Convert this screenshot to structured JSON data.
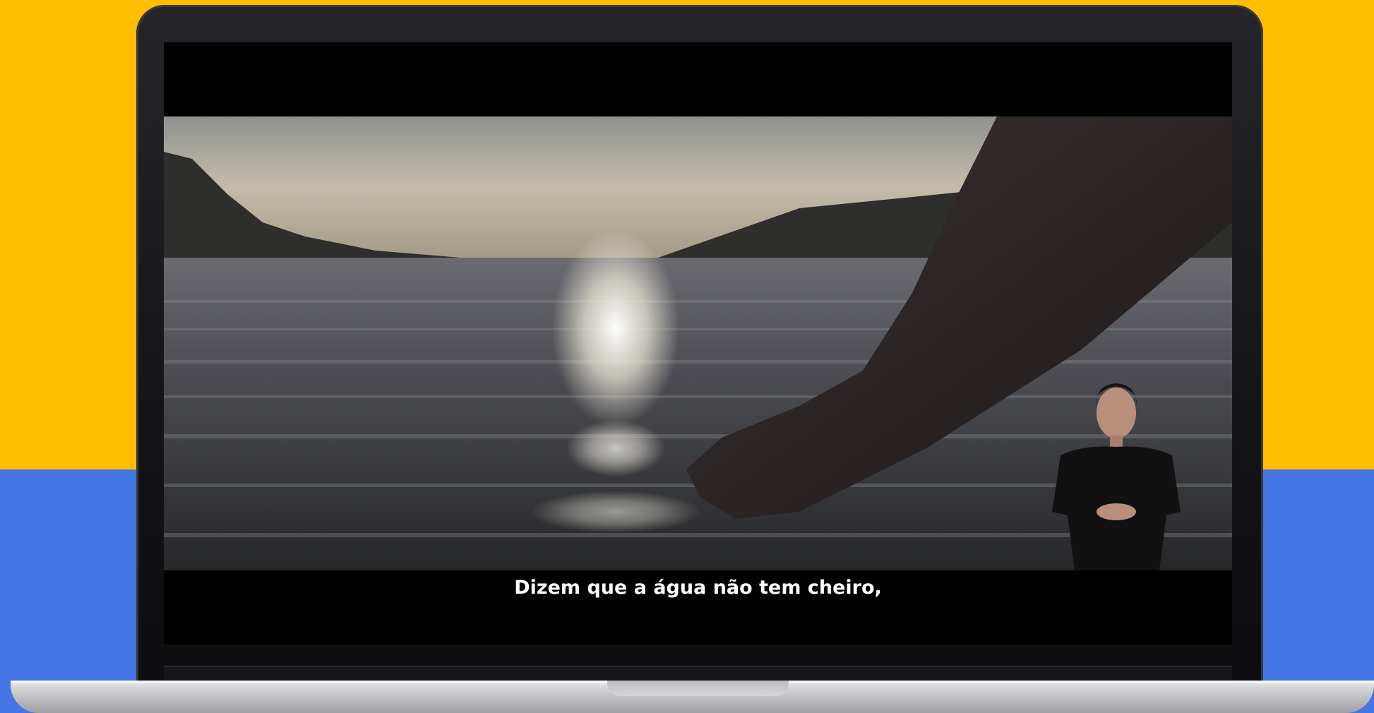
{
  "video": {
    "subtitle": "Dizem que a água não tem cheiro,"
  },
  "colors": {
    "background_top": "#FFBE00",
    "background_bottom": "#4476E6",
    "screen": "#000000",
    "subtitle_text": "#FFFFFF"
  }
}
